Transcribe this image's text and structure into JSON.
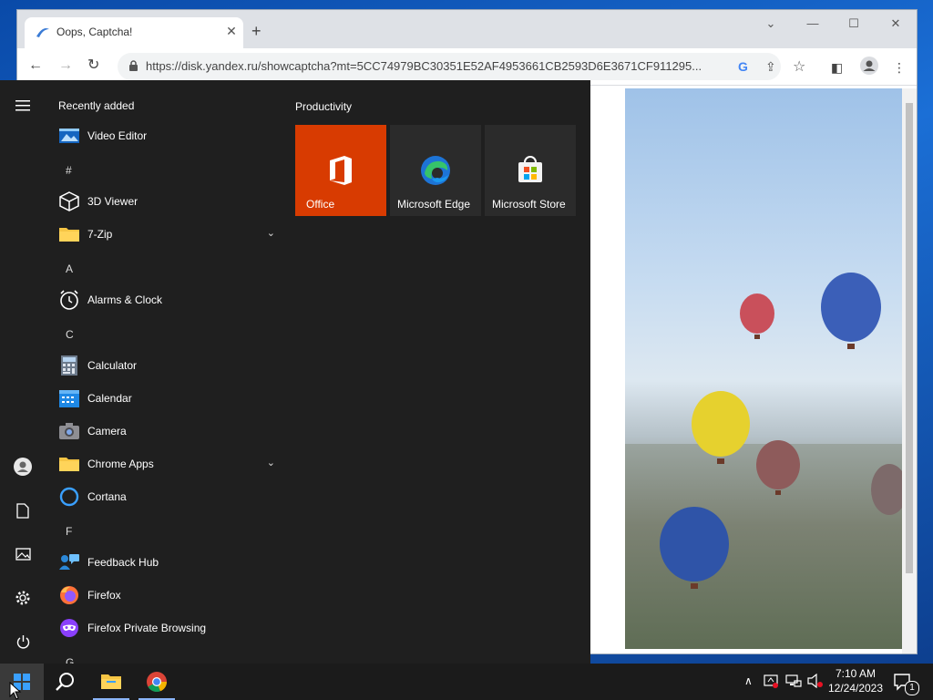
{
  "browser": {
    "tab_title": "Oops, Captcha!",
    "tab_close": "✕",
    "new_tab": "+",
    "url": "https://disk.yandex.ru/showcaptcha?mt=5CC74979BC30351E52AF4953661CB2593D6E3671CF911295...",
    "omnibox_google": "G",
    "controls": {
      "tab_search": "⌄",
      "minimize": "—",
      "maximize": "☐",
      "close": "✕"
    },
    "nav": {
      "back": "←",
      "forward": "→",
      "reload": "↻"
    },
    "icons": {
      "share": "⇪",
      "bookmark": "☆",
      "sidepanel": "◧",
      "profile": "●",
      "menu": "⋮"
    }
  },
  "start_menu": {
    "section_title": "Recently added",
    "tiles_group_title": "Productivity",
    "apps": [
      {
        "label": "Video Editor",
        "icon": "film-icon"
      },
      {
        "label": "3D Viewer",
        "icon": "cube-icon"
      },
      {
        "label": "7-Zip",
        "icon": "folder-icon",
        "expandable": true
      },
      {
        "label": "Alarms & Clock",
        "icon": "alarm-clock-icon"
      },
      {
        "label": "Calculator",
        "icon": "calculator-icon"
      },
      {
        "label": "Calendar",
        "icon": "calendar-icon"
      },
      {
        "label": "Camera",
        "icon": "camera-icon"
      },
      {
        "label": "Chrome Apps",
        "icon": "folder-icon",
        "expandable": true
      },
      {
        "label": "Cortana",
        "icon": "cortana-icon"
      },
      {
        "label": "Feedback Hub",
        "icon": "feedback-icon"
      },
      {
        "label": "Firefox",
        "icon": "firefox-icon"
      },
      {
        "label": "Firefox Private Browsing",
        "icon": "firefox-private-icon"
      }
    ],
    "letters": [
      "#",
      "A",
      "C",
      "F",
      "G"
    ],
    "chevron": "⌄",
    "tiles": [
      {
        "label": "Office",
        "color": "#d83b01"
      },
      {
        "label": "Microsoft Edge",
        "color": "#2b2b2b"
      },
      {
        "label": "Microsoft Store",
        "color": "#2b2b2b"
      }
    ]
  },
  "taskbar": {
    "tray_chevron": "∧",
    "time": "7:10 AM",
    "date": "12/24/2023",
    "notification_count": "1"
  },
  "colors": {
    "start_bg": "#1f1f1f",
    "taskbar_bg": "#1b1b1b",
    "office_tile": "#d83b01",
    "accent": "#0078d7"
  }
}
